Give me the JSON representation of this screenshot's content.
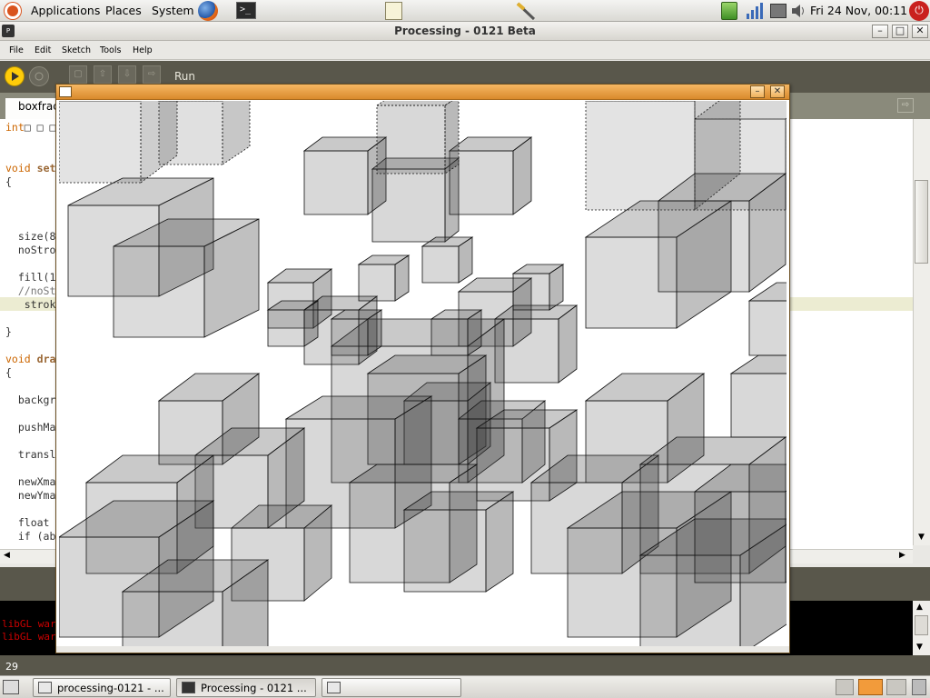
{
  "top_panel": {
    "menus": [
      "Applications",
      "Places",
      "System"
    ],
    "clock": "Fri 24 Nov, 00:11"
  },
  "window": {
    "title": "Processing - 0121 Beta",
    "menus": [
      "File",
      "Edit",
      "Sketch",
      "Tools",
      "Help"
    ],
    "toolbar": {
      "run_label": "Run"
    },
    "tab_name": "boxfrac",
    "code_lines": [
      {
        "kw": "int",
        "rest": "□ □ □"
      },
      {
        "kw": "void",
        "bold": "set",
        "rest": ""
      },
      {
        "kw": "",
        "rest": "{"
      },
      {
        "kw": "",
        "rest": "  size(8"
      },
      {
        "kw": "",
        "rest": "  noStro"
      },
      {
        "kw": "",
        "rest": "  fill(1"
      },
      {
        "kw": "",
        "rest": "  //noSt"
      },
      {
        "kw": "",
        "rest": "   strok"
      },
      {
        "kw": "",
        "rest": "}"
      },
      {
        "kw": "void",
        "bold": "dra",
        "rest": ""
      },
      {
        "kw": "",
        "rest": "{"
      },
      {
        "kw": "",
        "rest": "  backgr"
      },
      {
        "kw": "",
        "rest": "  pushMa"
      },
      {
        "kw": "",
        "rest": "  transl"
      },
      {
        "kw": "",
        "rest": "  newXma"
      },
      {
        "kw": "",
        "rest": "  newYma"
      },
      {
        "kw": "",
        "rest": "  float "
      },
      {
        "kw": "",
        "rest": "  if (ab"
      }
    ],
    "console_lines": [
      "libGL war",
      "libGL war"
    ],
    "line_number": "29"
  },
  "taskbar": {
    "tasks": [
      "processing-0121 - ...",
      "Processing - 0121 ...",
      ""
    ]
  },
  "colors": {
    "toolbar_bg": "#59574b",
    "run_button": "#fecc0a",
    "console_text": "#cc0000",
    "sketch_titlebar": "#e89b3e"
  },
  "icons": [
    "ubuntu-logo-icon",
    "firefox-icon",
    "terminal-icon",
    "text-editor-icon",
    "network-tool-icon",
    "battery-icon",
    "signal-icon",
    "network-icon",
    "volume-icon",
    "power-icon"
  ]
}
